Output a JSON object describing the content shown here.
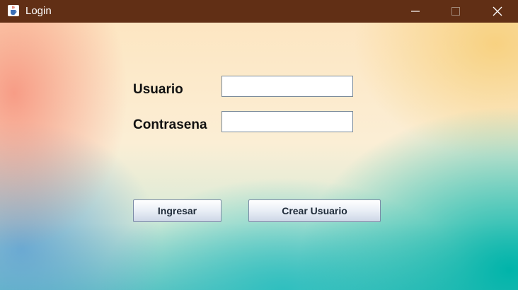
{
  "window": {
    "title": "Login",
    "app_icon": "java-cup-icon",
    "controls": [
      "minimize-icon",
      "maximize-icon",
      "close-icon"
    ],
    "titlebar_color": "#612f15"
  },
  "form": {
    "usuario_label": "Usuario",
    "usuario_value": "",
    "contrasena_label": "Contrasena",
    "contrasena_value": ""
  },
  "buttons": {
    "ingresar_label": "Ingresar",
    "crear_usuario_label": "Crear Usuario"
  }
}
